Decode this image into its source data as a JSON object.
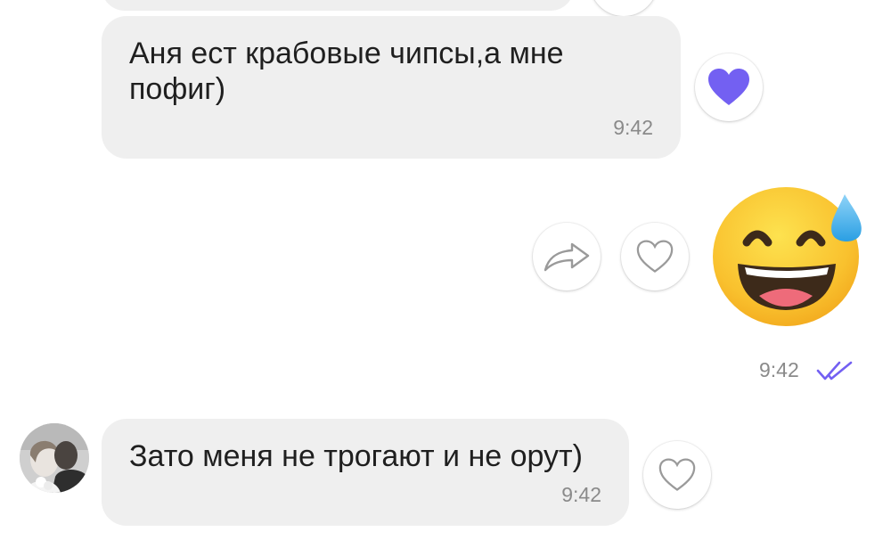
{
  "messages": [
    {
      "text": "Аня ест крабовые чипсы,а мне пофиг)",
      "time": "9:42",
      "reaction": "heart-filled"
    },
    {
      "sticker": "grinning-face-with-sweat-emoji",
      "time": "9:42",
      "status": "read-double-check"
    },
    {
      "text": "Зато меня не трогают и не орут)",
      "time": "9:42",
      "reaction": "heart-outline"
    }
  ],
  "colors": {
    "bubble": "#efefef",
    "accent": "#7360f2",
    "time": "#8a8a8a",
    "text": "#1f1f1f"
  },
  "icons": {
    "reaction_filled": "heart-icon",
    "reaction_empty": "heart-outline-icon",
    "forward": "share-arrow-icon",
    "read_status": "double-check-icon"
  }
}
